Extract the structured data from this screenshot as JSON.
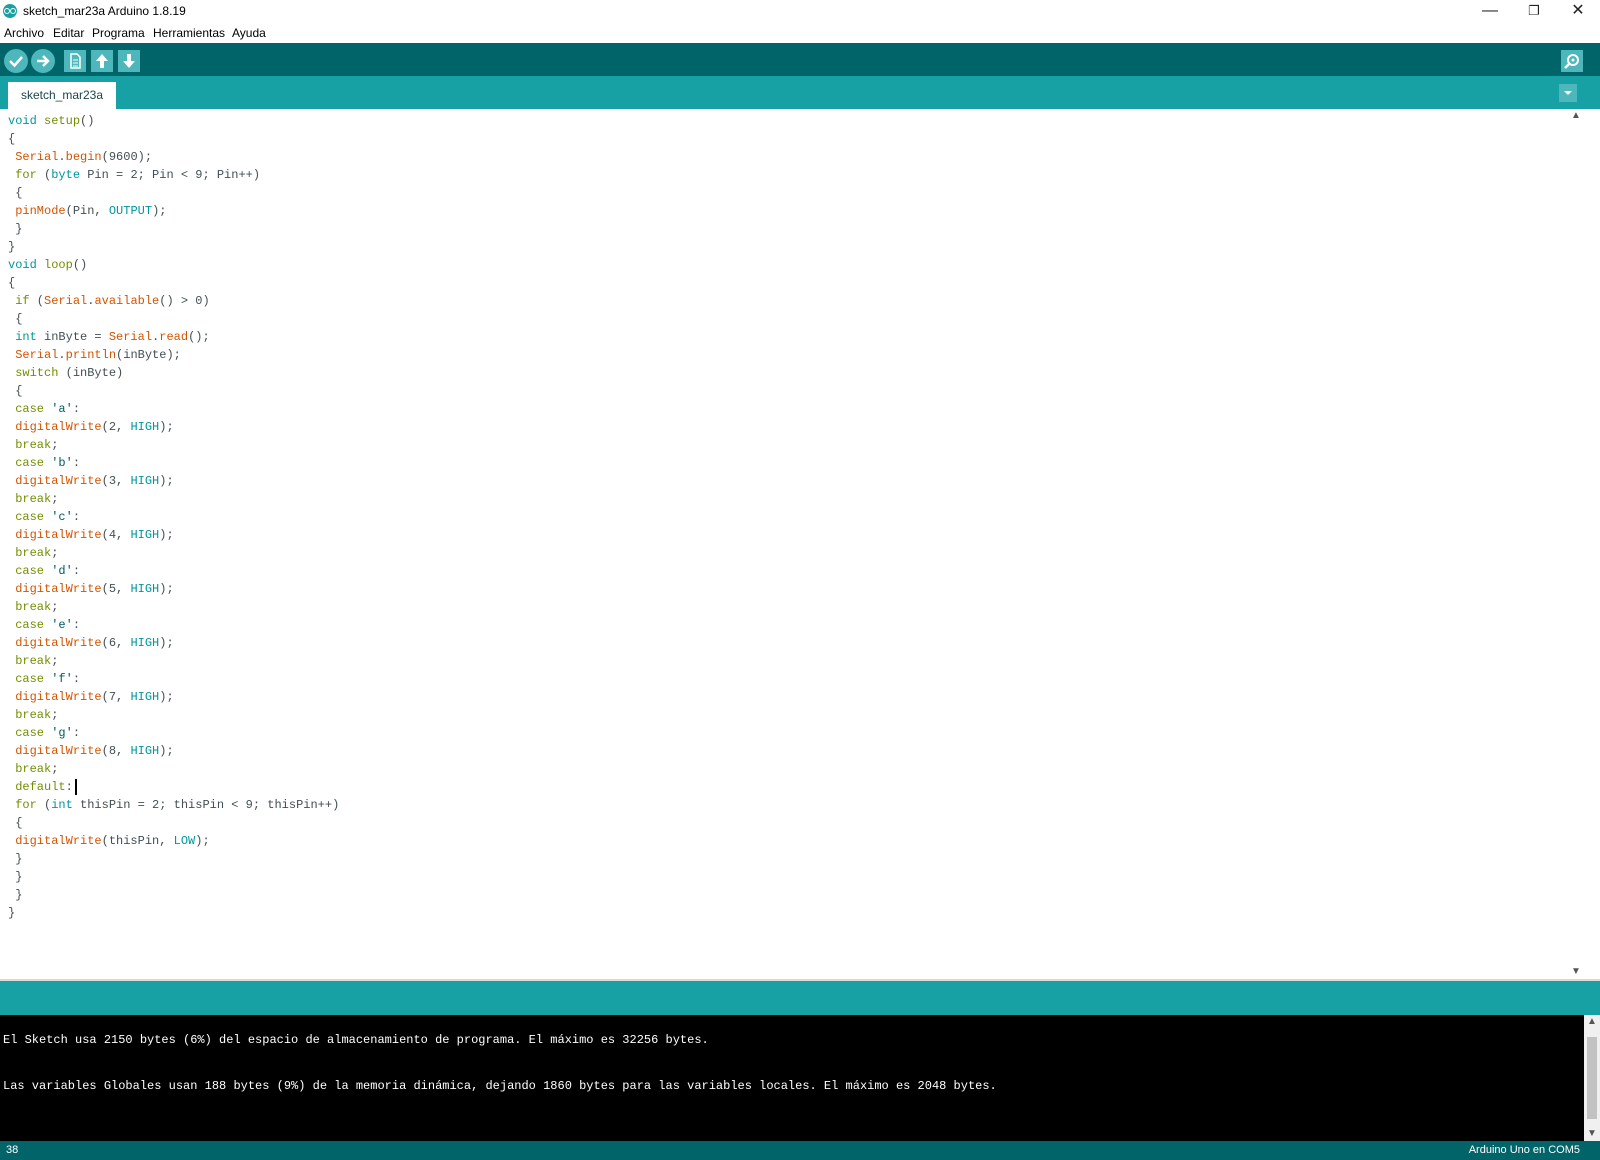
{
  "window": {
    "title": "sketch_mar23a Arduino 1.8.19",
    "minimize_glyph": "—",
    "maximize_glyph": "❐",
    "close_glyph": "✕"
  },
  "menu": {
    "items": [
      "Archivo",
      "Editar",
      "Programa",
      "Herramientas",
      "Ayuda"
    ]
  },
  "toolbar": {
    "icons": [
      "verify-icon",
      "upload-icon",
      "new-icon",
      "open-icon",
      "save-icon",
      "serial-monitor-icon"
    ]
  },
  "tab": {
    "name": "sketch_mar23a",
    "menu_glyph": "▼"
  },
  "editor": {
    "lines": [
      [
        [
          "kw",
          "void"
        ],
        [
          "txt",
          " "
        ],
        [
          "ctrl",
          "setup"
        ],
        [
          "txt",
          "()"
        ]
      ],
      [
        [
          "txt",
          "{"
        ]
      ],
      [
        [
          "txt",
          " "
        ],
        [
          "fn",
          "Serial"
        ],
        [
          "txt",
          "."
        ],
        [
          "fn",
          "begin"
        ],
        [
          "txt",
          "(9600);"
        ]
      ],
      [
        [
          "txt",
          " "
        ],
        [
          "ctrl",
          "for"
        ],
        [
          "txt",
          " ("
        ],
        [
          "kw",
          "byte"
        ],
        [
          "txt",
          " Pin = 2; Pin < 9; Pin++)"
        ]
      ],
      [
        [
          "txt",
          " {"
        ]
      ],
      [
        [
          "txt",
          " "
        ],
        [
          "fn",
          "pinMode"
        ],
        [
          "txt",
          "(Pin, "
        ],
        [
          "const",
          "OUTPUT"
        ],
        [
          "txt",
          ");"
        ]
      ],
      [
        [
          "txt",
          " }"
        ]
      ],
      [
        [
          "txt",
          "}"
        ]
      ],
      [
        [
          "kw",
          "void"
        ],
        [
          "txt",
          " "
        ],
        [
          "ctrl",
          "loop"
        ],
        [
          "txt",
          "()"
        ]
      ],
      [
        [
          "txt",
          "{"
        ]
      ],
      [
        [
          "txt",
          " "
        ],
        [
          "ctrl",
          "if"
        ],
        [
          "txt",
          " ("
        ],
        [
          "fn",
          "Serial"
        ],
        [
          "txt",
          "."
        ],
        [
          "fn",
          "available"
        ],
        [
          "txt",
          "() > 0)"
        ]
      ],
      [
        [
          "txt",
          " {"
        ]
      ],
      [
        [
          "txt",
          " "
        ],
        [
          "kw",
          "int"
        ],
        [
          "txt",
          " inByte = "
        ],
        [
          "fn",
          "Serial"
        ],
        [
          "txt",
          "."
        ],
        [
          "fn",
          "read"
        ],
        [
          "txt",
          "();"
        ]
      ],
      [
        [
          "txt",
          " "
        ],
        [
          "fn",
          "Serial"
        ],
        [
          "txt",
          "."
        ],
        [
          "fn",
          "println"
        ],
        [
          "txt",
          "(inByte);"
        ]
      ],
      [
        [
          "txt",
          " "
        ],
        [
          "ctrl",
          "switch"
        ],
        [
          "txt",
          " (inByte)"
        ]
      ],
      [
        [
          "txt",
          " {"
        ]
      ],
      [
        [
          "txt",
          " "
        ],
        [
          "ctrl",
          "case"
        ],
        [
          "txt",
          " "
        ],
        [
          "str",
          "'a'"
        ],
        [
          "txt",
          ":"
        ]
      ],
      [
        [
          "txt",
          " "
        ],
        [
          "fn",
          "digitalWrite"
        ],
        [
          "txt",
          "(2, "
        ],
        [
          "const",
          "HIGH"
        ],
        [
          "txt",
          ");"
        ]
      ],
      [
        [
          "txt",
          " "
        ],
        [
          "ctrl",
          "break"
        ],
        [
          "txt",
          ";"
        ]
      ],
      [
        [
          "txt",
          " "
        ],
        [
          "ctrl",
          "case"
        ],
        [
          "txt",
          " "
        ],
        [
          "str",
          "'b'"
        ],
        [
          "txt",
          ":"
        ]
      ],
      [
        [
          "txt",
          " "
        ],
        [
          "fn",
          "digitalWrite"
        ],
        [
          "txt",
          "(3, "
        ],
        [
          "const",
          "HIGH"
        ],
        [
          "txt",
          ");"
        ]
      ],
      [
        [
          "txt",
          " "
        ],
        [
          "ctrl",
          "break"
        ],
        [
          "txt",
          ";"
        ]
      ],
      [
        [
          "txt",
          " "
        ],
        [
          "ctrl",
          "case"
        ],
        [
          "txt",
          " "
        ],
        [
          "str",
          "'c'"
        ],
        [
          "txt",
          ":"
        ]
      ],
      [
        [
          "txt",
          " "
        ],
        [
          "fn",
          "digitalWrite"
        ],
        [
          "txt",
          "(4, "
        ],
        [
          "const",
          "HIGH"
        ],
        [
          "txt",
          ");"
        ]
      ],
      [
        [
          "txt",
          " "
        ],
        [
          "ctrl",
          "break"
        ],
        [
          "txt",
          ";"
        ]
      ],
      [
        [
          "txt",
          " "
        ],
        [
          "ctrl",
          "case"
        ],
        [
          "txt",
          " "
        ],
        [
          "str",
          "'d'"
        ],
        [
          "txt",
          ":"
        ]
      ],
      [
        [
          "txt",
          " "
        ],
        [
          "fn",
          "digitalWrite"
        ],
        [
          "txt",
          "(5, "
        ],
        [
          "const",
          "HIGH"
        ],
        [
          "txt",
          ");"
        ]
      ],
      [
        [
          "txt",
          " "
        ],
        [
          "ctrl",
          "break"
        ],
        [
          "txt",
          ";"
        ]
      ],
      [
        [
          "txt",
          " "
        ],
        [
          "ctrl",
          "case"
        ],
        [
          "txt",
          " "
        ],
        [
          "str",
          "'e'"
        ],
        [
          "txt",
          ":"
        ]
      ],
      [
        [
          "txt",
          " "
        ],
        [
          "fn",
          "digitalWrite"
        ],
        [
          "txt",
          "(6, "
        ],
        [
          "const",
          "HIGH"
        ],
        [
          "txt",
          ");"
        ]
      ],
      [
        [
          "txt",
          " "
        ],
        [
          "ctrl",
          "break"
        ],
        [
          "txt",
          ";"
        ]
      ],
      [
        [
          "txt",
          " "
        ],
        [
          "ctrl",
          "case"
        ],
        [
          "txt",
          " "
        ],
        [
          "str",
          "'f'"
        ],
        [
          "txt",
          ":"
        ]
      ],
      [
        [
          "txt",
          " "
        ],
        [
          "fn",
          "digitalWrite"
        ],
        [
          "txt",
          "(7, "
        ],
        [
          "const",
          "HIGH"
        ],
        [
          "txt",
          ");"
        ]
      ],
      [
        [
          "txt",
          " "
        ],
        [
          "ctrl",
          "break"
        ],
        [
          "txt",
          ";"
        ]
      ],
      [
        [
          "txt",
          " "
        ],
        [
          "ctrl",
          "case"
        ],
        [
          "txt",
          " "
        ],
        [
          "str",
          "'g'"
        ],
        [
          "txt",
          ":"
        ]
      ],
      [
        [
          "txt",
          " "
        ],
        [
          "fn",
          "digitalWrite"
        ],
        [
          "txt",
          "(8, "
        ],
        [
          "const",
          "HIGH"
        ],
        [
          "txt",
          ");"
        ]
      ],
      [
        [
          "txt",
          " "
        ],
        [
          "ctrl",
          "break"
        ],
        [
          "txt",
          ";"
        ]
      ],
      [
        [
          "txt",
          " "
        ],
        [
          "ctrl",
          "default"
        ],
        [
          "txt",
          ":"
        ]
      ],
      [
        [
          "txt",
          " "
        ],
        [
          "ctrl",
          "for"
        ],
        [
          "txt",
          " ("
        ],
        [
          "kw",
          "int"
        ],
        [
          "txt",
          " thisPin = 2; thisPin < 9; thisPin++)"
        ]
      ],
      [
        [
          "txt",
          " {"
        ]
      ],
      [
        [
          "txt",
          " "
        ],
        [
          "fn",
          "digitalWrite"
        ],
        [
          "txt",
          "(thisPin, "
        ],
        [
          "const",
          "LOW"
        ],
        [
          "txt",
          ");"
        ]
      ],
      [
        [
          "txt",
          " }"
        ]
      ],
      [
        [
          "txt",
          " }"
        ]
      ],
      [
        [
          "txt",
          " }"
        ]
      ],
      [
        [
          "txt",
          "}"
        ]
      ]
    ],
    "cursor_line": 38
  },
  "console": {
    "lines": [
      "El Sketch usa 2150 bytes (6%) del espacio de almacenamiento de programa. El máximo es 32256 bytes.",
      "Las variables Globales usan 188 bytes (9%) de la memoria dinámica, dejando 1860 bytes para las variables locales. El máximo es 2048 bytes."
    ]
  },
  "status": {
    "line_number": "38",
    "board": "Arduino Uno en COM5"
  },
  "colors": {
    "toolbar": "#006468",
    "tabbar": "#17a1a5",
    "button": "#4db7bb",
    "keyword": "#00979c",
    "function": "#d35400",
    "control": "#728e00",
    "string": "#005c5f",
    "text": "#434f54"
  }
}
